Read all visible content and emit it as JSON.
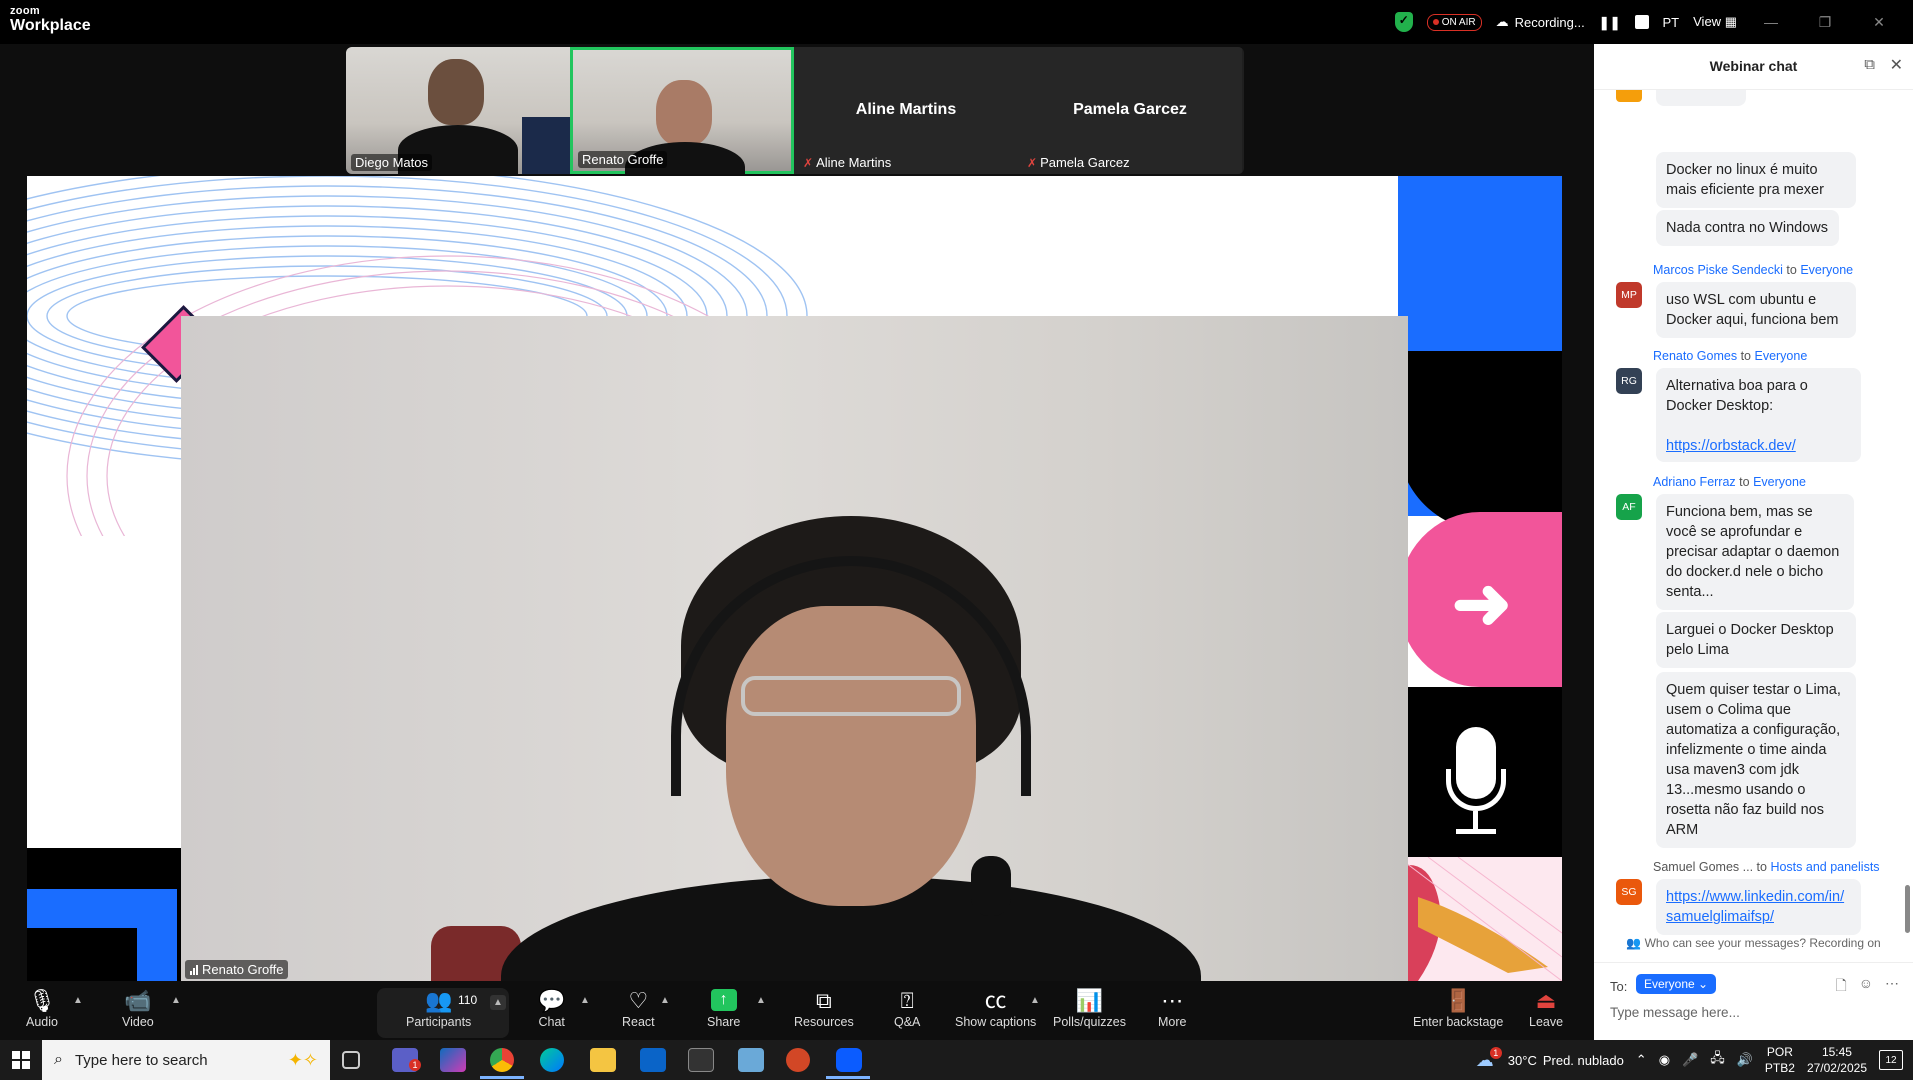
{
  "app": {
    "brand_small": "zoom",
    "brand_big": "Workplace",
    "on_air": "ON AIR",
    "recording": "Recording...",
    "language": "PT",
    "view": "View",
    "colors": {
      "accent": "#1a6dff",
      "active_border": "#22c55e",
      "muted": "#e0443e",
      "share": "#22c55e",
      "leave": "#e0443e"
    }
  },
  "gallery": {
    "tiles": [
      {
        "name": "Diego Matos",
        "type": "video",
        "muted": false
      },
      {
        "name": "Renato Groffe",
        "type": "video",
        "muted": false,
        "active": true
      },
      {
        "name": "Aline Martins",
        "type": "name-only",
        "muted": true
      },
      {
        "name": "Pamela Garcez",
        "type": "name-only",
        "muted": true
      }
    ]
  },
  "stage": {
    "speaker_name": "Renato Groffe"
  },
  "chat": {
    "title": "Webinar chat",
    "messages": [
      {
        "text": "Docker no linux é muito mais eficiente pra mexer"
      },
      {
        "text": "Nada contra no Windows"
      },
      {
        "sender": "Marcos Piske Sendecki",
        "to_word": "to",
        "recipient": "Everyone",
        "initials": "MP",
        "avatar_color": "#c0392b",
        "text": "uso WSL com ubuntu e Docker aqui, funciona bem"
      },
      {
        "sender": "Renato Gomes",
        "to_word": "to",
        "recipient": "Everyone",
        "initials": "RG",
        "avatar_color": "#334155",
        "text": "Alternativa boa para o Docker Desktop:",
        "link": "https://orbstack.dev/"
      },
      {
        "sender": "Adriano Ferraz",
        "to_word": "to",
        "recipient": "Everyone",
        "initials": "AF",
        "avatar_color": "#16a34a",
        "text": "Funciona bem, mas se você se aprofundar e precisar adaptar o daemon do docker.d nele o bicho senta..."
      },
      {
        "text": "Larguei o Docker Desktop pelo Lima"
      },
      {
        "text": "Quem quiser testar o Lima, usem o Colima que automatiza a configuração, infelizmente o time ainda usa maven3 com jdk 13...mesmo usando o rosetta não faz build nos ARM"
      },
      {
        "sender": "Samuel Gomes ...",
        "to_word": "to",
        "recipient": "Hosts and panelists",
        "initials": "SG",
        "avatar_color": "#ea580c",
        "link": "https://www.linkedin.com/in/samuelglimaifsp/"
      }
    ],
    "notice": "Who can see your messages? Recording on",
    "to_label": "To:",
    "to_value": "Everyone",
    "placeholder": "Type message here..."
  },
  "toolbar": {
    "audio": "Audio",
    "video": "Video",
    "participants": "Participants",
    "participants_count": "110",
    "chat": "Chat",
    "react": "React",
    "share": "Share",
    "resources": "Resources",
    "qa": "Q&A",
    "captions": "Show captions",
    "polls": "Polls/quizzes",
    "more": "More",
    "backstage": "Enter backstage",
    "leave": "Leave"
  },
  "taskbar": {
    "search_placeholder": "Type here to search",
    "temperature": "30°C",
    "weather": "Pred. nublado",
    "lang_1": "POR",
    "lang_2": "PTB2",
    "time": "15:45",
    "date": "27/02/2025",
    "notifications": "12",
    "teams_badge": "1",
    "weather_badge": "1"
  }
}
